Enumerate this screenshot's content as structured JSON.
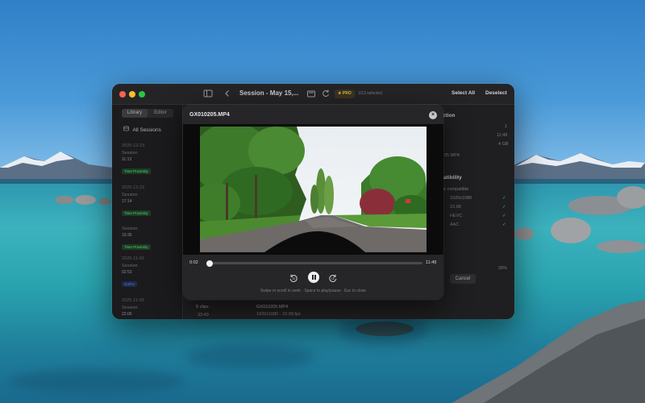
{
  "window": {
    "title": "Session - May 15,...",
    "pro_label": "★ PRO",
    "selected_count": "1/13 selected",
    "select_all_label": "Select All",
    "deselect_label": "Deselect"
  },
  "sidebar": {
    "tabs": [
      "Library",
      "Editor"
    ],
    "all_sessions_label": "All Sessions",
    "sessions": [
      {
        "date": "2025-12-23",
        "name": "Session",
        "time": "11:13",
        "badge": "Time Proximity"
      },
      {
        "date": "2025-12-22",
        "name": "Session",
        "time": "17:14",
        "badge": "Time Proximity"
      },
      {
        "date": "",
        "name": "Session",
        "time": "19:35",
        "badge": "Time Proximity"
      },
      {
        "date": "2025-11-03",
        "name": "Session",
        "time": "02:53",
        "badge": "GoPro"
      },
      {
        "date": "2025-11-03",
        "name": "Session",
        "time": "22:06",
        "badge": ""
      }
    ]
  },
  "background_panel": {
    "section_title": "ction",
    "value_1": "1",
    "value_2": "11:49",
    "value_3": "4 GB",
    "filename_fragment": "05.MP4",
    "compat_title": "atibility",
    "compat_sub": "e compatible",
    "specs": [
      "1920x1080",
      "23.98",
      "HEVC",
      "AAC"
    ],
    "progress_pct": "26%",
    "cancel_label": "Cancel",
    "clips_count": "5 clips",
    "clips_duration": "33:49",
    "row_file": "GX010205.MP4",
    "row_specs": "1920x1080 · 23.98 fps"
  },
  "player": {
    "filename": "GX010205.MP4",
    "current_time": "0:02",
    "duration": "11:49",
    "progress": 0.003,
    "hint": "Swipe or scroll to seek · Space to play/pause · Esc to close",
    "skip_back_label": "15",
    "skip_fwd_label": "15"
  },
  "colors": {
    "accent_green": "#4cd964",
    "accent_blue": "#4a7cff",
    "pro_gold": "#e3b23c"
  }
}
